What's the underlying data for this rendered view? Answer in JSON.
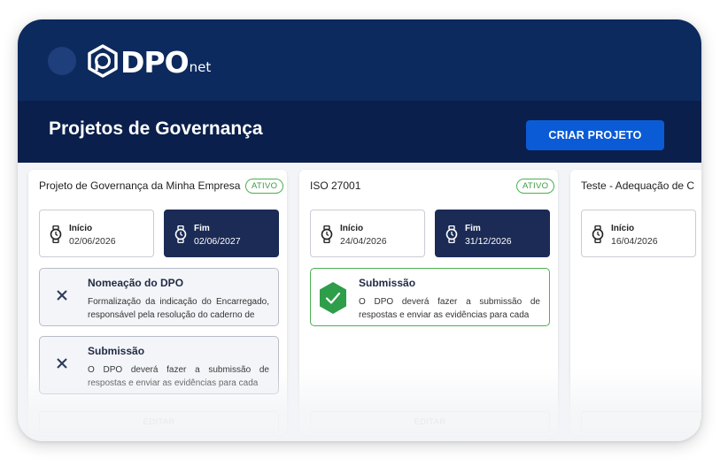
{
  "header": {
    "logo_text": "DPO",
    "logo_suffix": "net"
  },
  "page": {
    "title": "Projetos de Governança",
    "create_button": "CRIAR PROJETO"
  },
  "colors": {
    "header_bg": "#0d2a5e",
    "title_bar_bg": "#0a1f4b",
    "primary_button": "#0b5bd6",
    "status_green": "#4caf50",
    "dark_date_bg": "#1b2b55"
  },
  "projects": [
    {
      "title": "Projeto de Governança da Minha Empresa",
      "status": "ATIVO",
      "start_label": "Início",
      "start_date": "02/06/2026",
      "end_label": "Fim",
      "end_date": "02/06/2027",
      "tasks": [
        {
          "title": "Nomeação do DPO",
          "description": "Formalização da indicação do Encarregado, responsável pela resolução do caderno de",
          "icon": "x-icon"
        },
        {
          "title": "Submissão",
          "description": "O DPO deverá fazer a submissão de respostas e enviar as evidências para cada",
          "icon": "x-icon"
        }
      ],
      "edit_label": "EDITAR"
    },
    {
      "title": "ISO 27001",
      "status": "ATIVO",
      "start_label": "Início",
      "start_date": "24/04/2026",
      "end_label": "Fim",
      "end_date": "31/12/2026",
      "tasks": [
        {
          "title": "Submissão",
          "description": "O DPO deverá fazer a submissão de respostas e enviar as evidências para cada",
          "icon": "check-hexagon-icon"
        }
      ],
      "edit_label": "EDITAR"
    },
    {
      "title": "Teste - Adequação de C",
      "start_label": "Início",
      "start_date": "16/04/2026",
      "edit_label": "E"
    }
  ]
}
